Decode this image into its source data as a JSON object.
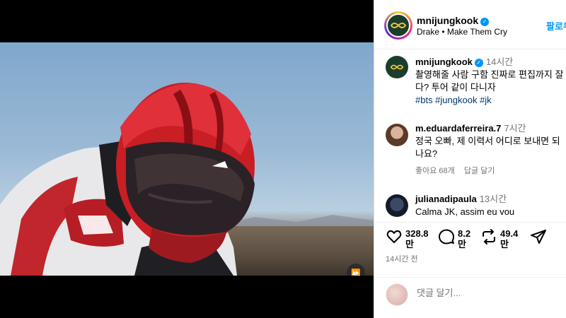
{
  "post": {
    "author": "mnijungkook",
    "audio": "Drake • Make Them Cry",
    "follow_label": "팔로우"
  },
  "video": {
    "speed_label": "2x"
  },
  "caption": {
    "username": "mnijungkook",
    "time": "14시간",
    "text": "촬영해줄 사람 구함 진짜로 편집까지 잘 다? 투어 같이 다니자",
    "hashtags": "#bts #jungkook #jk"
  },
  "comments": [
    {
      "username": "m.eduardaferreira.7",
      "time": "7시간",
      "text": "정국 오빠, 제 이력서 어디로 보내면 되나요?",
      "likes": "좋아요 68개",
      "reply": "답글 달기"
    },
    {
      "username": "julianadipaula",
      "time": "13시간",
      "text": "Calma JK, assim eu vou"
    }
  ],
  "actions": {
    "likes": "328.8만",
    "comments": "8.2만",
    "reposts": "49.4만"
  },
  "post_time": "14시간 전",
  "add_comment": {
    "placeholder": "댓글 달기..."
  },
  "colors": {
    "link": "#0095f6",
    "hashtag": "#00376b",
    "muted": "#737373"
  }
}
